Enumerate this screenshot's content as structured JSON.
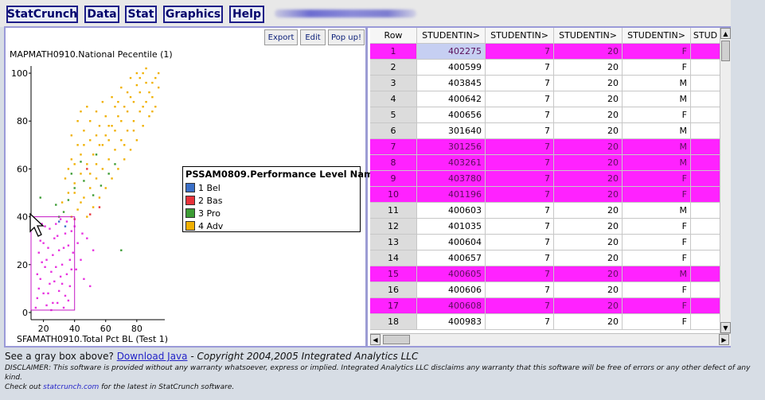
{
  "menu": [
    "StatCrunch",
    "Data",
    "Stat",
    "Graphics",
    "Help"
  ],
  "graph_toolbar": [
    "Export",
    "Edit",
    "Pop up!"
  ],
  "chart_data": {
    "type": "scatter",
    "title": "MAPMATH0910.National Pecentile (1)",
    "xlabel": "SFAMATH0910.Total Pct BL (Test 1)",
    "ylabel": "MAPMATH0910.National Pecentile (1)",
    "xlim": [
      12,
      98
    ],
    "ylim": [
      -3,
      103
    ],
    "xticks": [
      20,
      40,
      60,
      80
    ],
    "yticks": [
      0,
      20,
      40,
      60,
      80,
      100
    ],
    "selection_box": {
      "x": [
        12,
        40
      ],
      "y": [
        1,
        40
      ]
    },
    "legend": {
      "title": "PSSAM0809.Performance Level Name",
      "placement": "middle-right",
      "entries": [
        {
          "label": "1 Bel",
          "color": "#3a6fc7"
        },
        {
          "label": "2 Bas",
          "color": "#e8323a"
        },
        {
          "label": "3 Pro",
          "color": "#3c9c34"
        },
        {
          "label": "4 Adv",
          "color": "#f0b000"
        }
      ]
    },
    "series": [
      {
        "name": "Selected",
        "color": "#e832e0",
        "points": [
          [
            15,
            2
          ],
          [
            16,
            6
          ],
          [
            17,
            10
          ],
          [
            18,
            14
          ],
          [
            19,
            21
          ],
          [
            20,
            29
          ],
          [
            21,
            36
          ],
          [
            22,
            3
          ],
          [
            23,
            8
          ],
          [
            24,
            12
          ],
          [
            25,
            17
          ],
          [
            26,
            24
          ],
          [
            27,
            31
          ],
          [
            28,
            37
          ],
          [
            29,
            4
          ],
          [
            30,
            9
          ],
          [
            31,
            15
          ],
          [
            32,
            20
          ],
          [
            33,
            27
          ],
          [
            34,
            33
          ],
          [
            35,
            38
          ],
          [
            36,
            5
          ],
          [
            37,
            11
          ],
          [
            38,
            18
          ],
          [
            39,
            25
          ],
          [
            16,
            16
          ],
          [
            18,
            30
          ],
          [
            20,
            8
          ],
          [
            22,
            22
          ],
          [
            24,
            35
          ],
          [
            26,
            4
          ],
          [
            28,
            19
          ],
          [
            30,
            26
          ],
          [
            32,
            12
          ],
          [
            34,
            7
          ],
          [
            36,
            28
          ],
          [
            38,
            34
          ],
          [
            25,
            1
          ],
          [
            33,
            2
          ],
          [
            37,
            22
          ],
          [
            21,
            19
          ],
          [
            27,
            13
          ],
          [
            29,
            32
          ],
          [
            31,
            39
          ],
          [
            35,
            16
          ],
          [
            23,
            27
          ],
          [
            19,
            37
          ],
          [
            17,
            25
          ],
          [
            40,
            36
          ],
          [
            42,
            29
          ],
          [
            44,
            22
          ],
          [
            46,
            14
          ],
          [
            48,
            31
          ],
          [
            50,
            11
          ],
          [
            52,
            26
          ],
          [
            45,
            33
          ],
          [
            41,
            18
          ]
        ]
      },
      {
        "name": "1 Bel",
        "color": "#3a6fc7",
        "points": [
          [
            30,
            38
          ],
          [
            34,
            36
          ]
        ]
      },
      {
        "name": "2 Bas",
        "color": "#e8323a",
        "points": [
          [
            40,
            39
          ],
          [
            50,
            41
          ],
          [
            56,
            44
          ],
          [
            48,
            60
          ]
        ]
      },
      {
        "name": "3 Pro",
        "color": "#3c9c34",
        "points": [
          [
            18,
            48
          ],
          [
            28,
            45
          ],
          [
            33,
            42
          ],
          [
            36,
            47
          ],
          [
            40,
            52
          ],
          [
            46,
            55
          ],
          [
            52,
            49
          ],
          [
            57,
            53
          ],
          [
            62,
            58
          ],
          [
            66,
            62
          ],
          [
            70,
            26
          ],
          [
            44,
            63
          ],
          [
            54,
            66
          ],
          [
            38,
            58
          ],
          [
            30,
            40
          ]
        ]
      },
      {
        "name": "4 Adv",
        "color": "#f0b000",
        "points": [
          [
            38,
            40
          ],
          [
            42,
            43
          ],
          [
            46,
            48
          ],
          [
            50,
            52
          ],
          [
            54,
            56
          ],
          [
            58,
            60
          ],
          [
            62,
            64
          ],
          [
            66,
            68
          ],
          [
            70,
            72
          ],
          [
            74,
            76
          ],
          [
            78,
            80
          ],
          [
            82,
            84
          ],
          [
            86,
            88
          ],
          [
            88,
            92
          ],
          [
            90,
            96
          ],
          [
            92,
            98
          ],
          [
            84,
            100
          ],
          [
            80,
            95
          ],
          [
            76,
            90
          ],
          [
            72,
            86
          ],
          [
            68,
            82
          ],
          [
            64,
            78
          ],
          [
            60,
            74
          ],
          [
            56,
            70
          ],
          [
            52,
            66
          ],
          [
            48,
            62
          ],
          [
            44,
            58
          ],
          [
            40,
            54
          ],
          [
            36,
            50
          ],
          [
            32,
            46
          ],
          [
            34,
            56
          ],
          [
            38,
            64
          ],
          [
            42,
            70
          ],
          [
            46,
            76
          ],
          [
            50,
            80
          ],
          [
            54,
            84
          ],
          [
            58,
            88
          ],
          [
            62,
            72
          ],
          [
            66,
            76
          ],
          [
            70,
            80
          ],
          [
            74,
            84
          ],
          [
            78,
            88
          ],
          [
            82,
            92
          ],
          [
            86,
            96
          ],
          [
            90,
            90
          ],
          [
            94,
            94
          ],
          [
            92,
            86
          ],
          [
            88,
            82
          ],
          [
            84,
            78
          ],
          [
            80,
            72
          ],
          [
            76,
            68
          ],
          [
            72,
            64
          ],
          [
            68,
            60
          ],
          [
            64,
            56
          ],
          [
            60,
            52
          ],
          [
            56,
            48
          ],
          [
            52,
            44
          ],
          [
            48,
            40
          ],
          [
            44,
            46
          ],
          [
            40,
            50
          ],
          [
            36,
            60
          ],
          [
            42,
            80
          ],
          [
            48,
            86
          ],
          [
            44,
            66
          ],
          [
            50,
            58
          ],
          [
            54,
            74
          ],
          [
            60,
            82
          ],
          [
            64,
            90
          ],
          [
            70,
            94
          ],
          [
            76,
            98
          ],
          [
            80,
            100
          ],
          [
            86,
            102
          ],
          [
            74,
            92
          ],
          [
            68,
            88
          ],
          [
            62,
            78
          ],
          [
            58,
            70
          ],
          [
            54,
            62
          ],
          [
            46,
            70
          ],
          [
            40,
            62
          ],
          [
            38,
            74
          ],
          [
            44,
            84
          ],
          [
            50,
            72
          ],
          [
            56,
            78
          ],
          [
            66,
            86
          ],
          [
            72,
            70
          ],
          [
            78,
            76
          ],
          [
            84,
            86
          ],
          [
            90,
            84
          ],
          [
            94,
            100
          ],
          [
            82,
            98
          ]
        ]
      }
    ]
  },
  "table": {
    "columns": [
      "Row",
      "STUDENTIN>",
      "STUDENTIN>",
      "STUDENTIN>",
      "STUDENTIN>",
      "STUD"
    ],
    "rows": [
      {
        "row": "1",
        "id": "402275",
        "a": "7",
        "b": "20",
        "g": "F",
        "sel": true
      },
      {
        "row": "2",
        "id": "400599",
        "a": "7",
        "b": "20",
        "g": "F",
        "sel": false
      },
      {
        "row": "3",
        "id": "403845",
        "a": "7",
        "b": "20",
        "g": "M",
        "sel": false
      },
      {
        "row": "4",
        "id": "400642",
        "a": "7",
        "b": "20",
        "g": "M",
        "sel": false
      },
      {
        "row": "5",
        "id": "400656",
        "a": "7",
        "b": "20",
        "g": "F",
        "sel": false
      },
      {
        "row": "6",
        "id": "301640",
        "a": "7",
        "b": "20",
        "g": "M",
        "sel": false
      },
      {
        "row": "7",
        "id": "301256",
        "a": "7",
        "b": "20",
        "g": "M",
        "sel": true
      },
      {
        "row": "8",
        "id": "403261",
        "a": "7",
        "b": "20",
        "g": "M",
        "sel": true
      },
      {
        "row": "9",
        "id": "403780",
        "a": "7",
        "b": "20",
        "g": "F",
        "sel": true
      },
      {
        "row": "10",
        "id": "401196",
        "a": "7",
        "b": "20",
        "g": "F",
        "sel": true
      },
      {
        "row": "11",
        "id": "400603",
        "a": "7",
        "b": "20",
        "g": "M",
        "sel": false
      },
      {
        "row": "12",
        "id": "401035",
        "a": "7",
        "b": "20",
        "g": "F",
        "sel": false
      },
      {
        "row": "13",
        "id": "400604",
        "a": "7",
        "b": "20",
        "g": "F",
        "sel": false
      },
      {
        "row": "14",
        "id": "400657",
        "a": "7",
        "b": "20",
        "g": "F",
        "sel": false
      },
      {
        "row": "15",
        "id": "400605",
        "a": "7",
        "b": "20",
        "g": "M",
        "sel": true
      },
      {
        "row": "16",
        "id": "400606",
        "a": "7",
        "b": "20",
        "g": "F",
        "sel": false
      },
      {
        "row": "17",
        "id": "400608",
        "a": "7",
        "b": "20",
        "g": "F",
        "sel": true
      },
      {
        "row": "18",
        "id": "400983",
        "a": "7",
        "b": "20",
        "g": "F",
        "sel": false
      }
    ]
  },
  "footer": {
    "gray_prefix": "See a gray box above?",
    "download_link": "Download Java",
    "copyright": "- Copyright 2004,2005 Integrated Analytics LLC",
    "disclaimer": "DISCLAIMER: This software is provided without any warranty whatsoever, express or implied. Integrated Analytics LLC disclaims any warranty that this software will be free of errors or any other defect of any kind.",
    "check_prefix": "Check out",
    "check_link": "statcrunch.com",
    "check_suffix": "for the latest in StatCrunch software."
  }
}
